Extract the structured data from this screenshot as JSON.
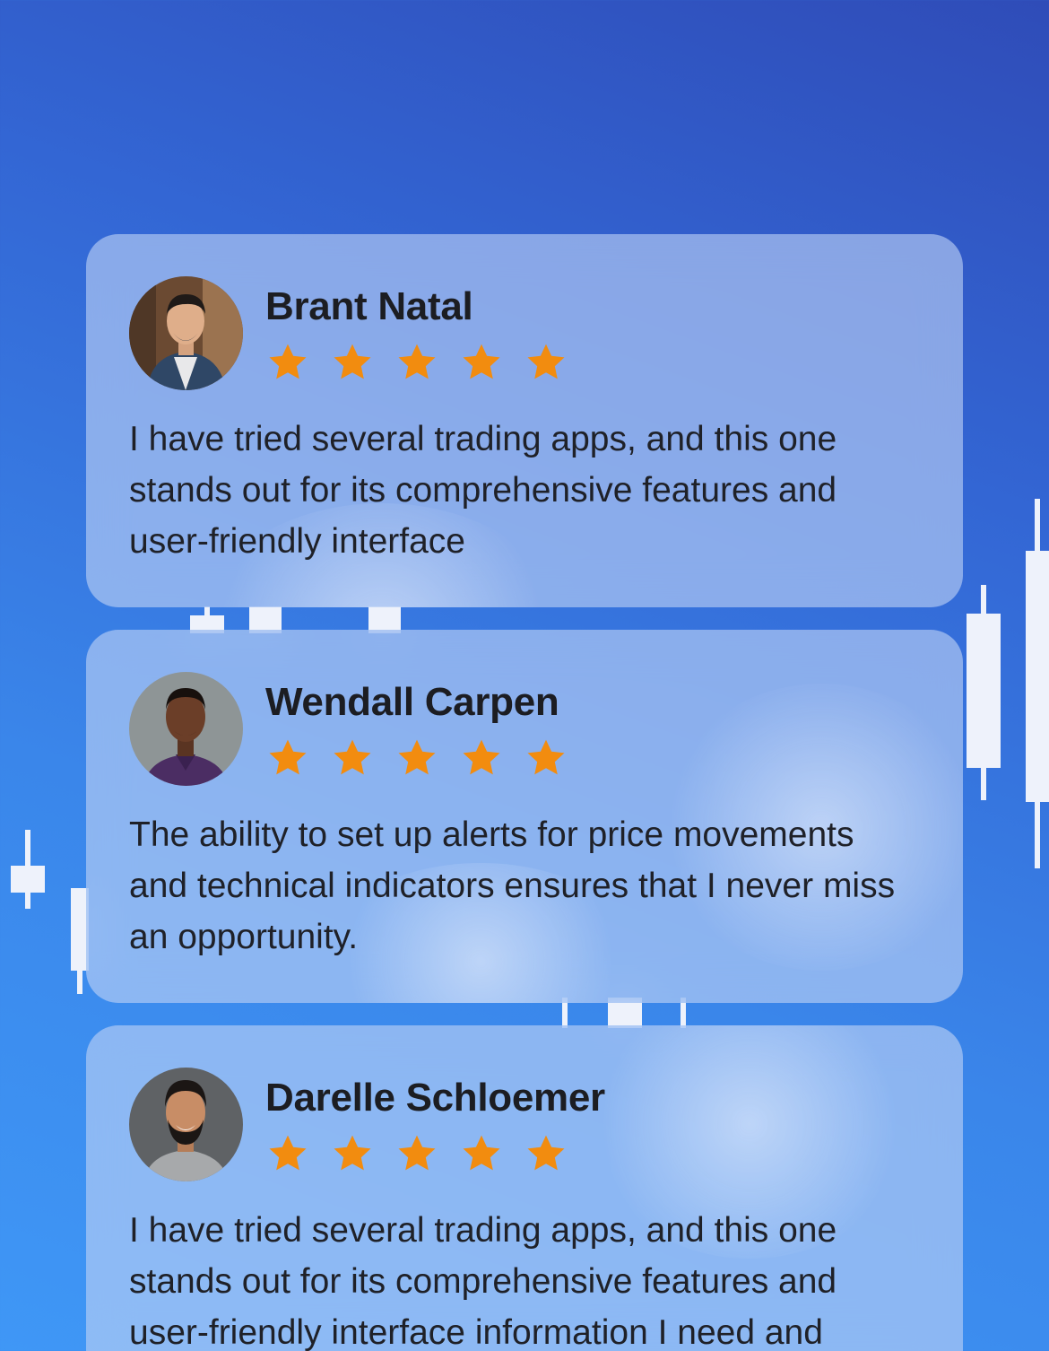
{
  "colors": {
    "background_top": "#2f4cb8",
    "background_bottom": "#3f97f6",
    "card": "#bed2f5",
    "star": "#f28c0f",
    "text": "#1f2128",
    "candle": "#eef2fb"
  },
  "reviews": [
    {
      "name": "Brant Natal",
      "rating": 5,
      "text": "I have tried several trading apps, and this one stands out for its comprehensive features and user-friendly interface"
    },
    {
      "name": "Wendall Carpen",
      "rating": 5,
      "text": "The ability to set up alerts for price movements and technical indicators ensures that I never miss an opportunity."
    },
    {
      "name": "Darelle Schloemer",
      "rating": 5,
      "text": "I have tried several trading apps, and this one stands out for its comprehensive features and user-friendly interface information I need and"
    }
  ],
  "icons": {
    "star": "star-icon",
    "avatar": "avatar"
  }
}
